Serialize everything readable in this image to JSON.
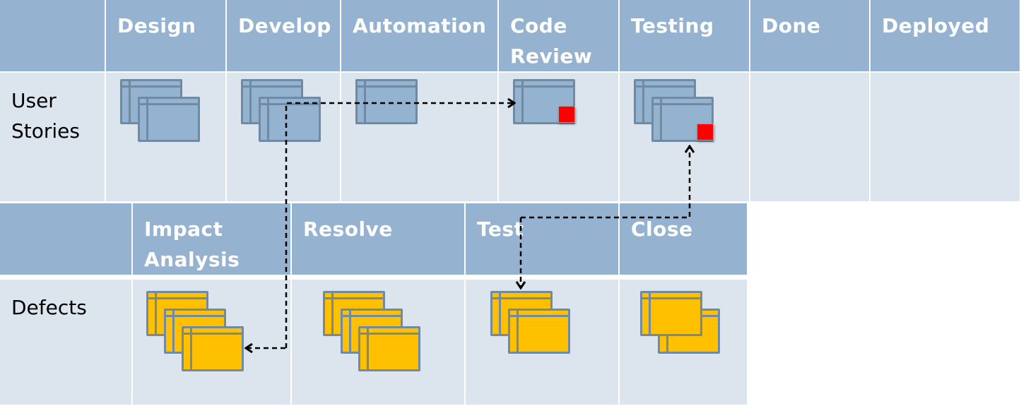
{
  "user_stories": {
    "row_label": "User\nStories",
    "columns": [
      {
        "label": "Design",
        "cards": 2,
        "blocked": false
      },
      {
        "label": "Develop",
        "cards": 2,
        "blocked": false
      },
      {
        "label": "Automation",
        "cards": 1,
        "blocked": false
      },
      {
        "label": "Code\nReview",
        "cards": 1,
        "blocked": true
      },
      {
        "label": "Testing",
        "cards": 2,
        "blocked": true
      },
      {
        "label": "Done",
        "cards": 0,
        "blocked": false
      },
      {
        "label": "Deployed",
        "cards": 0,
        "blocked": false
      }
    ]
  },
  "defects": {
    "row_label": "Defects",
    "columns": [
      {
        "label": "Impact\nAnalysis",
        "cards": 3
      },
      {
        "label": "Resolve",
        "cards": 3
      },
      {
        "label": "Test",
        "cards": 2
      },
      {
        "label": "Close",
        "cards": 2
      }
    ]
  },
  "colors": {
    "header": "#95b3d1",
    "cell": "#dce4ee",
    "story_card": "#94b3d1",
    "defect_card": "#ffc000",
    "blocker": "#ff0000"
  }
}
